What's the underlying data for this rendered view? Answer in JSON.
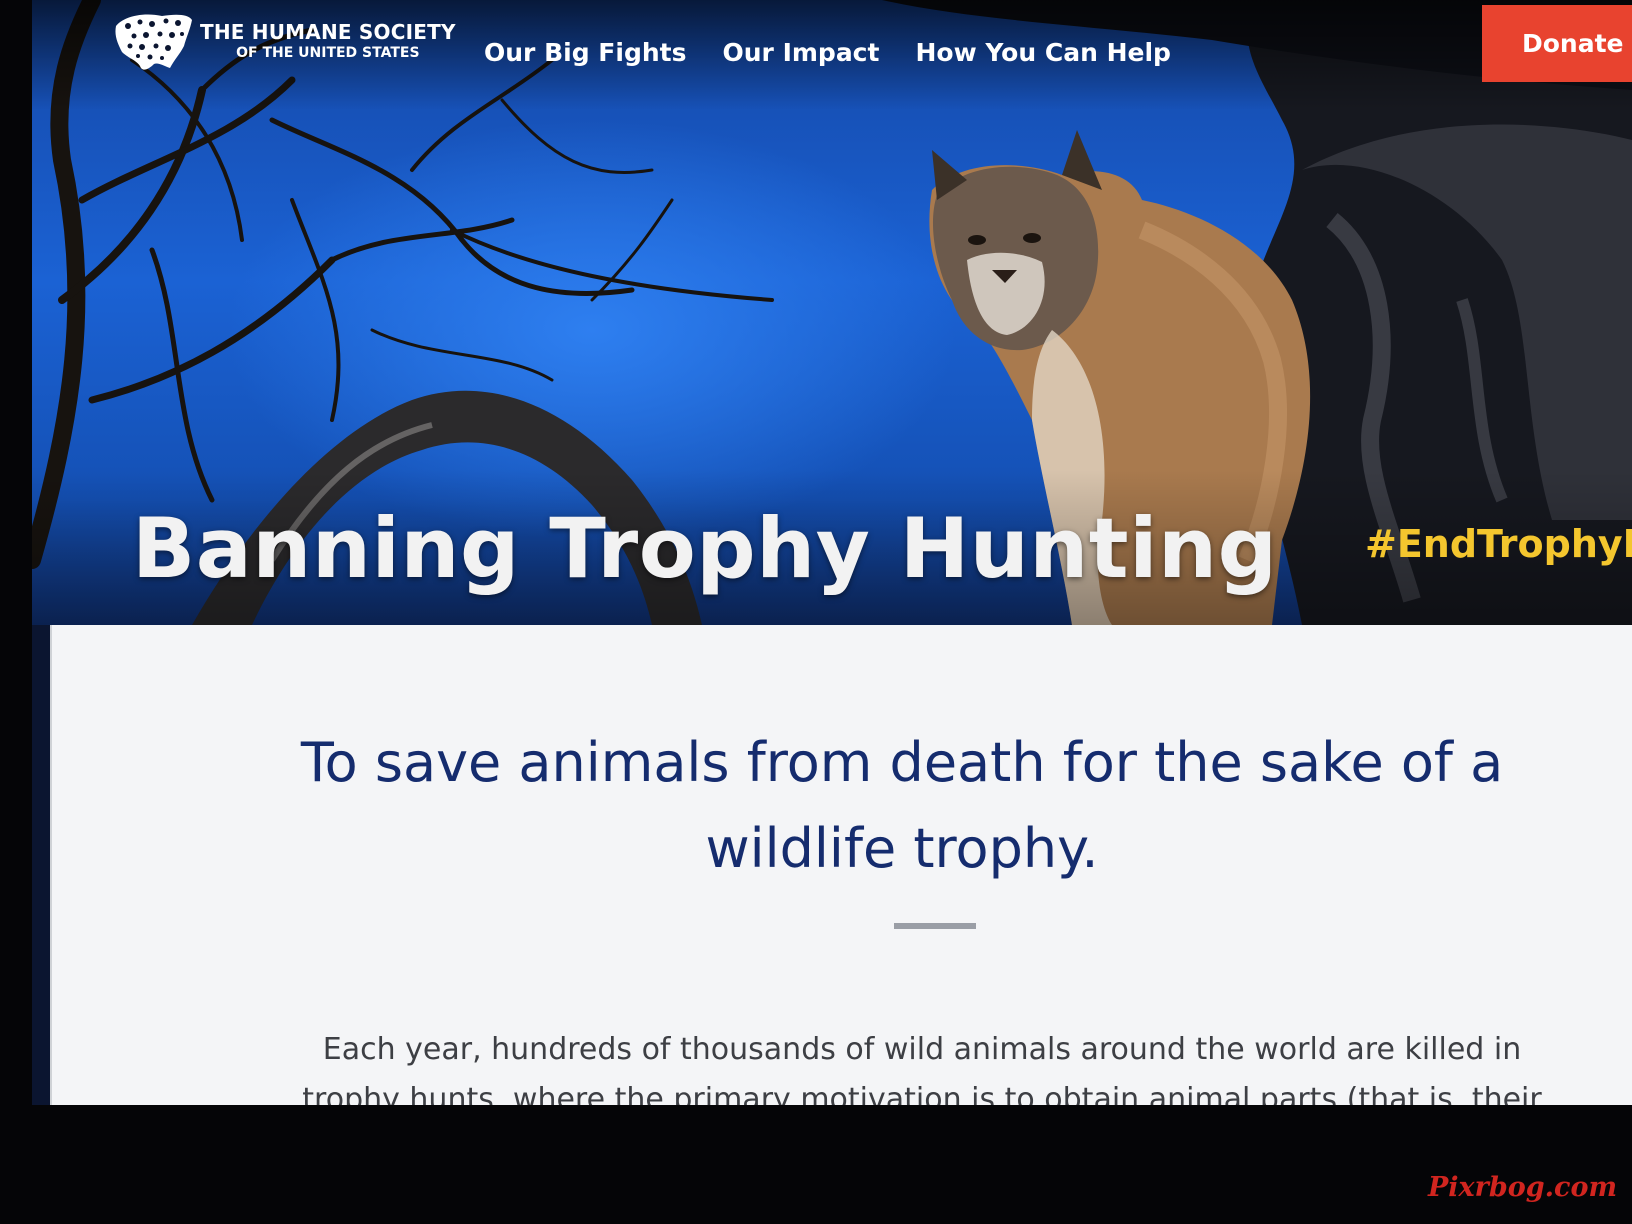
{
  "site": {
    "logo_line1": "THE HUMANE SOCIETY",
    "logo_line2": "OF THE UNITED STATES"
  },
  "nav": {
    "items": [
      "Our Big Fights",
      "Our Impact",
      "How You Can Help"
    ],
    "donate_label": "Donate"
  },
  "hero": {
    "title": "Banning Trophy Hunting",
    "hashtag": "#EndTrophyHu"
  },
  "content": {
    "mission": "To save animals from death for the sake of a wildlife trophy.",
    "body": "Each year, hundreds of thousands of wild animals around the world are killed in trophy hunts, where the primary motivation is to obtain animal parts (that is, their heads"
  },
  "watermark": "Pixrbog.com",
  "colors": {
    "donate": "#e8432f",
    "hashtag": "#f4c62e",
    "mission_text": "#152c6e",
    "sky": "#1b62d4"
  }
}
